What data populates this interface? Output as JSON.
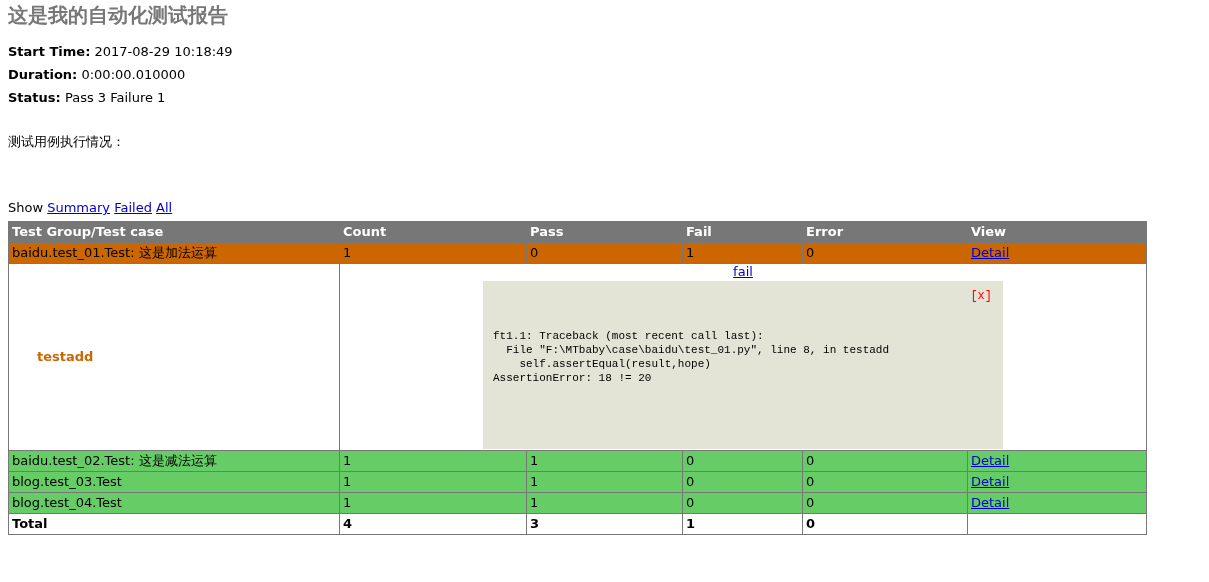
{
  "title": "这是我的自动化测试报告",
  "attributes": [
    {
      "label": "Start Time:",
      "value": "2017-08-29 10:18:49"
    },
    {
      "label": "Duration:",
      "value": "0:00:00.010000"
    },
    {
      "label": "Status:",
      "value": "Pass 3 Failure 1"
    }
  ],
  "description": "测试用例执行情况：",
  "filter": {
    "label": "Show",
    "links": [
      "Summary",
      "Failed",
      "All"
    ]
  },
  "table": {
    "columns": [
      "Test Group/Test case",
      "Count",
      "Pass",
      "Fail",
      "Error",
      "View"
    ],
    "rows": [
      {
        "color": "#cc6600",
        "name": "baidu.test_01.Test: 这是加法运算",
        "count": "1",
        "pass": "0",
        "fail": "1",
        "error": "0",
        "view": "Detail",
        "cases": [
          {
            "color": "#cc6600",
            "name": "testadd",
            "result": "fail",
            "close": "[x]",
            "output": [
              "ft1.1: Traceback (most recent call last):",
              "  File \"F:\\MTbaby\\case\\baidu\\test_01.py\", line 8, in testadd",
              "    self.assertEqual(result,hope)",
              "AssertionError: 18 != 20"
            ]
          }
        ]
      },
      {
        "color": "#66cc66",
        "name": "baidu.test_02.Test: 这是减法运算",
        "count": "1",
        "pass": "1",
        "fail": "0",
        "error": "0",
        "view": "Detail"
      },
      {
        "color": "#66cc66",
        "name": "blog.test_03.Test",
        "count": "1",
        "pass": "1",
        "fail": "0",
        "error": "0",
        "view": "Detail"
      },
      {
        "color": "#66cc66",
        "name": "blog.test_04.Test",
        "count": "1",
        "pass": "1",
        "fail": "0",
        "error": "0",
        "view": "Detail"
      }
    ],
    "total": {
      "label": "Total",
      "count": "4",
      "pass": "3",
      "fail": "1",
      "error": "0"
    }
  }
}
